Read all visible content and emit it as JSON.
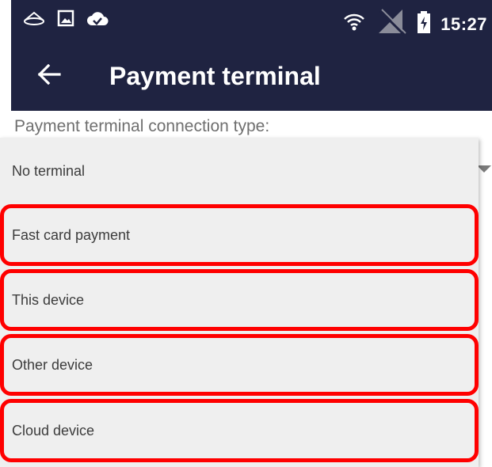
{
  "status_bar": {
    "time": "15:27",
    "icons": [
      "cast-icon",
      "image-icon",
      "cloud-check-icon",
      "wifi-icon",
      "no-signal-icon",
      "battery-charging-icon"
    ]
  },
  "app_bar": {
    "title": "Payment terminal",
    "back_icon": "arrow-left-icon"
  },
  "form": {
    "label": "Payment terminal connection type:",
    "selected": "No terminal",
    "options": [
      {
        "label": "No terminal",
        "highlighted": false
      },
      {
        "label": "Fast card payment",
        "highlighted": true
      },
      {
        "label": "This device",
        "highlighted": true
      },
      {
        "label": "Other device",
        "highlighted": true
      },
      {
        "label": "Cloud device",
        "highlighted": true
      }
    ]
  },
  "colors": {
    "app_bar": "#1f2341",
    "menu_bg": "#efefef",
    "highlight": "#ff0000",
    "label": "#6f6f6f"
  }
}
